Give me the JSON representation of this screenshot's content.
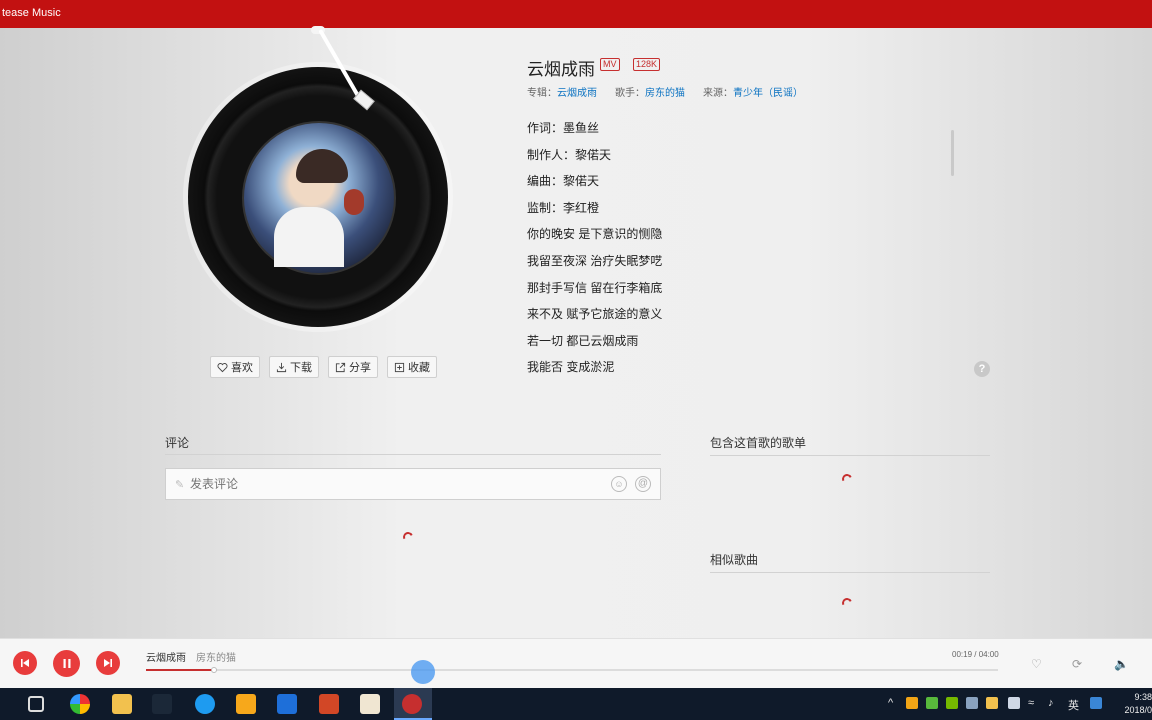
{
  "window": {
    "title": "tease Music"
  },
  "song": {
    "title": "云烟成雨",
    "badges": {
      "mv": "MV",
      "quality": "128K"
    },
    "album_label": "专辑：",
    "album": "云烟成雨",
    "artist_label": "歌手：",
    "artist": "房东的猫",
    "source_label": "来源：",
    "source": "青少年（民谣）"
  },
  "lyrics": [
    "作词：墨鱼丝",
    "制作人：黎偌天",
    "编曲：黎偌天",
    "监制：李红橙",
    "你的晚安 是下意识的恻隐",
    "我留至夜深 治疗失眠梦呓",
    "那封手写信 留在行李箱底",
    "来不及 赋予它旅途的意义",
    "若一切 都已云烟成雨",
    "我能否 变成淤泥"
  ],
  "actions": [
    {
      "label": "喜欢",
      "icon": "heart-icon"
    },
    {
      "label": "下载",
      "icon": "download-icon"
    },
    {
      "label": "分享",
      "icon": "share-icon"
    },
    {
      "label": "收藏",
      "icon": "collect-icon"
    }
  ],
  "help_label": "?",
  "comments": {
    "title": "评论",
    "placeholder": "发表评论",
    "emoji": "☺",
    "at": "@"
  },
  "sidebar": {
    "playlists_title": "包含这首歌的歌单",
    "similar_title": "相似歌曲"
  },
  "player": {
    "song": "云烟成雨",
    "artist": "房东的猫",
    "time": "00:19 / 04:00",
    "progress": 0.08
  },
  "taskbar": {
    "ime": "英",
    "clock_time": "9:38",
    "clock_date": "2018/0"
  },
  "colors": {
    "brand_red": "#c21111",
    "accent_red": "#e83c3c",
    "link_blue": "#0c73c2"
  }
}
